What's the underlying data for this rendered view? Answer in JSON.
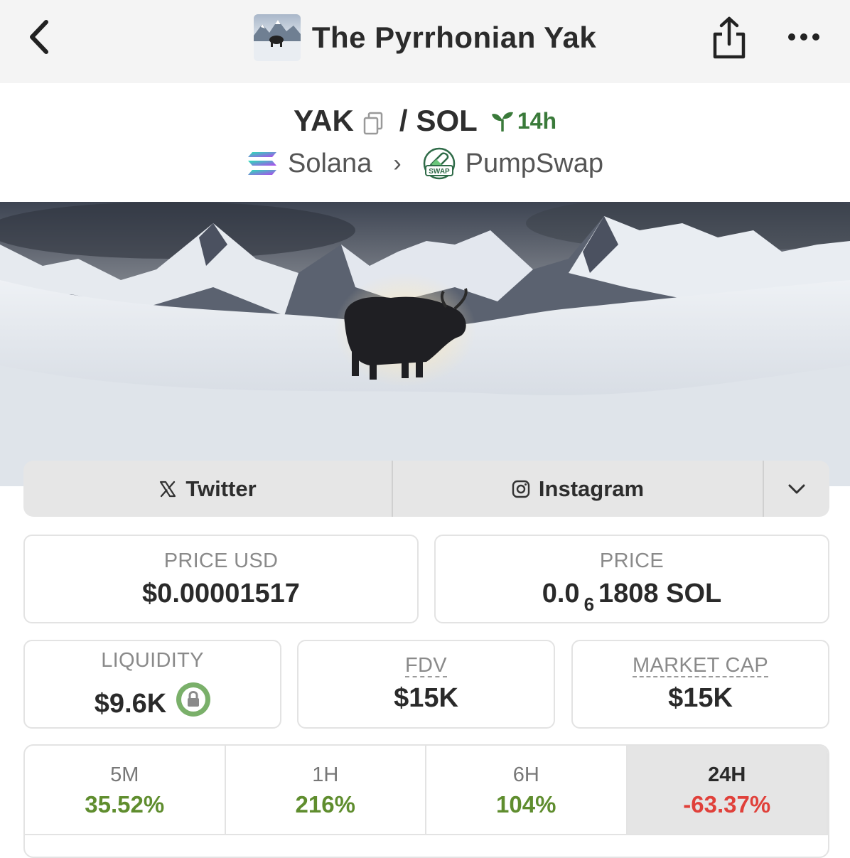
{
  "header": {
    "title": "The Pyrrhonian Yak"
  },
  "pair": {
    "base": "YAK",
    "separator": "/",
    "quote": "SOL",
    "age": "14h",
    "chain": "Solana",
    "dex": "PumpSwap",
    "dex_badge": "SWAP"
  },
  "socials": {
    "twitter": "Twitter",
    "instagram": "Instagram"
  },
  "stats": {
    "price_usd_label": "PRICE USD",
    "price_usd": "$0.00001517",
    "price_label": "PRICE",
    "price_prefix": "0.0",
    "price_zeros": "6",
    "price_suffix": "1808 SOL",
    "liquidity_label": "LIQUIDITY",
    "liquidity": "$9.6K",
    "fdv_label": "FDV",
    "fdv": "$15K",
    "mcap_label": "MARKET CAP",
    "mcap": "$15K"
  },
  "changes": [
    {
      "label": "5M",
      "value": "35.52%"
    },
    {
      "label": "1H",
      "value": "216%"
    },
    {
      "label": "6H",
      "value": "104%"
    },
    {
      "label": "24H",
      "value": "-63.37%"
    }
  ],
  "colors": {
    "positive": "#5f8d2e",
    "negative": "#e0403a",
    "age_green": "#3a7a3a"
  }
}
